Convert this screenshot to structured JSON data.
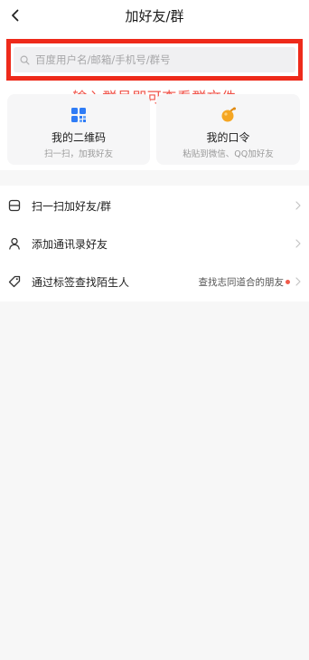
{
  "header": {
    "title": "加好友/群",
    "back_icon": "chevron-left-icon"
  },
  "search": {
    "placeholder": "百度用户名/邮箱/手机号/群号",
    "icon": "search-icon",
    "highlight_color": "#ee2a1b"
  },
  "annotation": {
    "text": "输入群号即可查看群文件",
    "color": "#f0544a"
  },
  "cards": [
    {
      "title": "我的二维码",
      "subtitle": "扫一扫，加我好友",
      "icon": "qr-code-icon",
      "icon_color": "#2f7cf6"
    },
    {
      "title": "我的口令",
      "subtitle": "粘贴到微信、QQ加好友",
      "icon": "token-key-icon",
      "icon_color": "#f5a623"
    }
  ],
  "menu": [
    {
      "label": "扫一扫加好友/群",
      "icon": "scan-icon"
    },
    {
      "label": "添加通讯录好友",
      "icon": "person-icon"
    },
    {
      "label": "通过标签查找陌生人",
      "icon": "tag-icon",
      "right_text": "查找志同道合的朋友"
    }
  ]
}
